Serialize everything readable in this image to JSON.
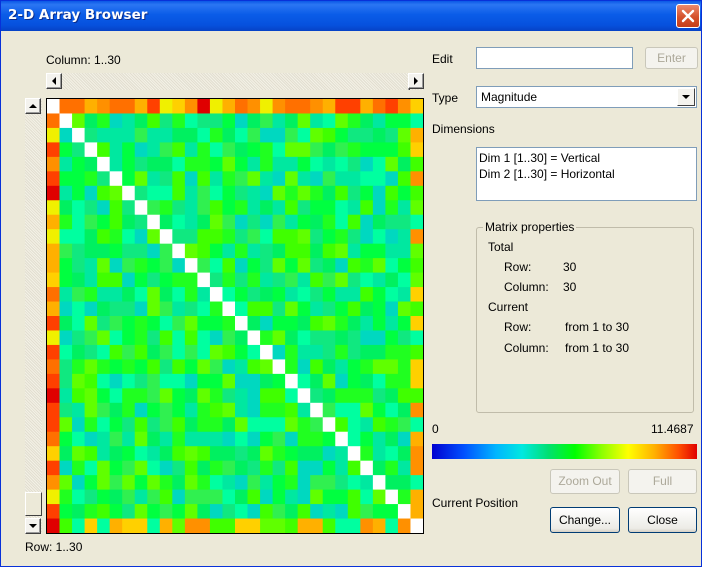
{
  "window": {
    "title": "2-D Array Browser"
  },
  "matrix_view": {
    "column_label": "Column: 1..30",
    "row_label": "Row: 1..30"
  },
  "edit": {
    "label": "Edit",
    "value": "",
    "enter_label": "Enter"
  },
  "type": {
    "label": "Type",
    "selected": "Magnitude"
  },
  "dimensions": {
    "label": "Dimensions",
    "items": [
      "Dim 1 [1..30] = Vertical",
      "Dim 2 [1..30] = Horizontal"
    ]
  },
  "matrix_properties": {
    "title": "Matrix properties",
    "total_label": "Total",
    "total_row_label": "Row:",
    "total_row_value": "30",
    "total_column_label": "Column:",
    "total_column_value": "30",
    "current_label": "Current",
    "current_row_label": "Row:",
    "current_row_value": "from 1 to 30",
    "current_column_label": "Column:",
    "current_column_value": "from 1 to 30"
  },
  "colorbar": {
    "min_label": "0",
    "max_label": "11.4687"
  },
  "buttons": {
    "zoom_out": "Zoom Out",
    "full": "Full",
    "change": "Change...",
    "close": "Close"
  },
  "current_position": {
    "label": "Current Position"
  },
  "colors": {
    "title_bar": "#0a5ce8",
    "window_bg": "#ece9d8",
    "diagonal": "#ffffff",
    "edge_hot": "#ff8000"
  }
}
